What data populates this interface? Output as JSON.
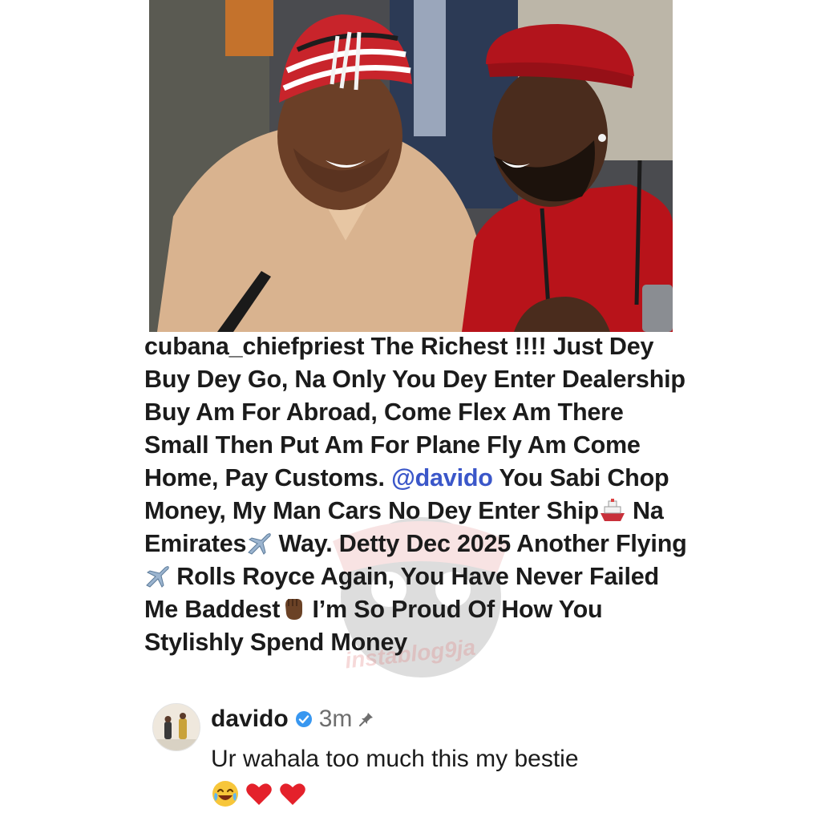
{
  "post": {
    "username": "cubana_chiefpriest",
    "caption_1": "The Richest !!!! Just Dey Buy Dey Go, Na Only You Dey Enter Dealership Buy Am For Abroad, Come Flex Am There Small Then Put Am For Plane Fly Am Come Home, Pay Customs.",
    "mention": "@davido",
    "caption_2": "You Sabi Chop Money, My Man Cars No Dey Enter Ship",
    "caption_3": "Na Emirates",
    "caption_4": "Way. Detty Dec 2025 Another Flying",
    "caption_5": "Rolls Royce Again, You Have Never Failed Me Baddest",
    "caption_6": "I’m So Proud Of How You Stylishly Spend Money",
    "watermark": "instablog9ja"
  },
  "reply": {
    "username": "davido",
    "time": "3m",
    "text": "Ur wahala too much this my bestie",
    "icons": [
      "verified-icon",
      "pin-icon",
      "laughing-emoji",
      "heart-emoji",
      "heart-emoji"
    ]
  },
  "colors": {
    "mention": "#3b57c9",
    "verified": "#3897f0",
    "text": "#1b1b1b",
    "muted": "#6e6e6e"
  }
}
